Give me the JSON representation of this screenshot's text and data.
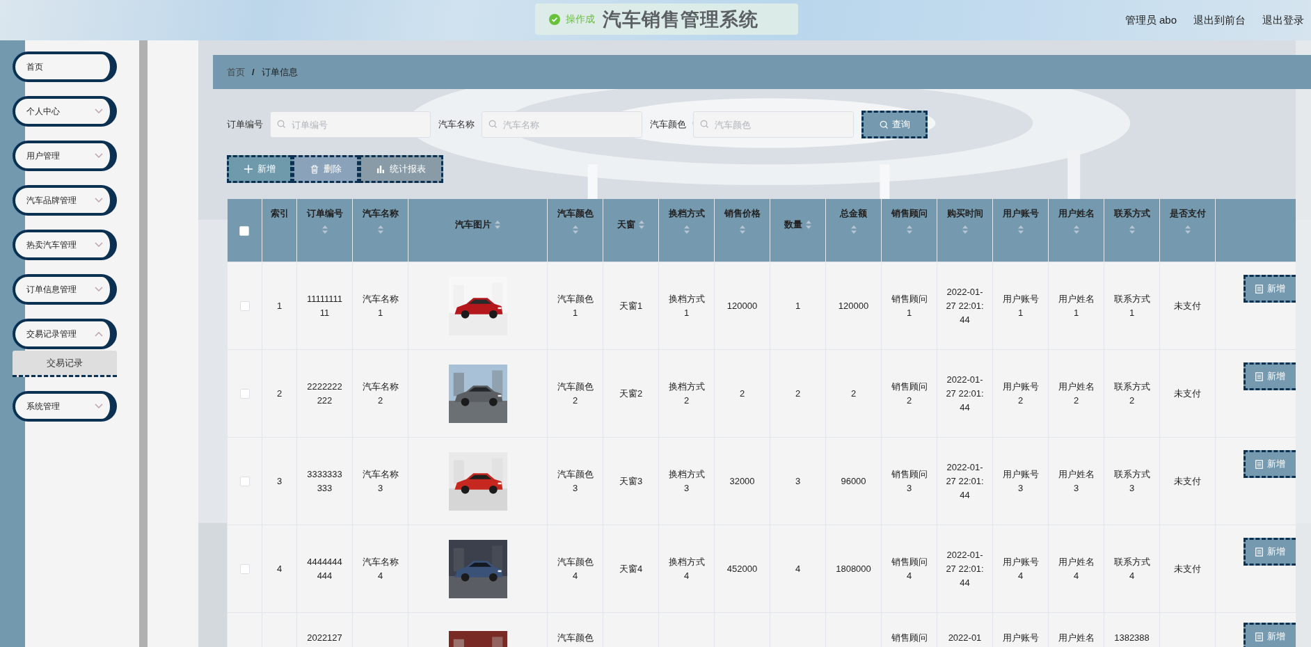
{
  "header": {
    "toast": {
      "text": "操作成"
    },
    "title": "汽车销售管理系统",
    "links": [
      "管理员 abo",
      "退出到前台",
      "退出登录"
    ]
  },
  "sidebar": {
    "items": [
      {
        "label": "首页",
        "kind": "link"
      },
      {
        "label": "个人中心",
        "kind": "group",
        "expanded": false
      },
      {
        "label": "用户管理",
        "kind": "group",
        "expanded": false
      },
      {
        "label": "汽车品牌管理",
        "kind": "group",
        "expanded": false
      },
      {
        "label": "热卖汽车管理",
        "kind": "group",
        "expanded": false
      },
      {
        "label": "订单信息管理",
        "kind": "group",
        "expanded": false
      },
      {
        "label": "交易记录管理",
        "kind": "group",
        "expanded": true,
        "children": [
          {
            "label": "交易记录",
            "hovered": true
          }
        ]
      },
      {
        "label": "系统管理",
        "kind": "group",
        "expanded": false
      }
    ]
  },
  "breadcrumb": {
    "items": [
      "首页",
      "订单信息"
    ],
    "separator": "/"
  },
  "search": {
    "fields": [
      {
        "label": "订单编号",
        "placeholder": "订单编号"
      },
      {
        "label": "汽车名称",
        "placeholder": "汽车名称"
      },
      {
        "label": "汽车颜色",
        "placeholder": "汽车颜色"
      }
    ],
    "button": "查询"
  },
  "toolbar": [
    {
      "label": "新增",
      "kind": "add"
    },
    {
      "label": "删除",
      "kind": "delete"
    },
    {
      "label": "统计报表",
      "kind": "report"
    }
  ],
  "table": {
    "select_all": {
      "checked": false
    },
    "columns": [
      {
        "label": "索引",
        "kind": "plain"
      },
      {
        "label": "订单编号",
        "kind": "sort"
      },
      {
        "label": "汽车名称",
        "kind": "sort"
      },
      {
        "label": "汽车图片",
        "kind": "sort_inline"
      },
      {
        "label": "汽车颜色",
        "kind": "sort"
      },
      {
        "label": "天窗",
        "kind": "sort_inline"
      },
      {
        "label": "换档方式",
        "kind": "sort"
      },
      {
        "label": "销售价格",
        "kind": "sort"
      },
      {
        "label": "数量",
        "kind": "sort_inline"
      },
      {
        "label": "总金额",
        "kind": "sort"
      },
      {
        "label": "销售顾问",
        "kind": "sort"
      },
      {
        "label": "购买时间",
        "kind": "sort"
      },
      {
        "label": "用户账号",
        "kind": "sort"
      },
      {
        "label": "用户姓名",
        "kind": "sort"
      },
      {
        "label": "联系方式",
        "kind": "sort"
      },
      {
        "label": "是否支付",
        "kind": "sort"
      }
    ],
    "rows": [
      {
        "checked": false,
        "cells": [
          "1",
          "1111111111",
          "汽车名称1",
          {
            "kind": "picture"
          },
          "汽车颜色1",
          "天窗1",
          "换档方式1",
          "120000",
          "1",
          "120000",
          "销售顾问1",
          "2022-01-27 22:01:44",
          "用户账号1",
          "用户姓名1",
          "联系方式1",
          "未支付"
        ],
        "actions": [
          "新增"
        ]
      },
      {
        "checked": false,
        "cells": [
          "2",
          "2222222222",
          "汽车名称2",
          {
            "kind": "picture"
          },
          "汽车颜色2",
          "天窗2",
          "换档方式2",
          "2",
          "2",
          "2",
          "销售顾问2",
          "2022-01-27 22:01:44",
          "用户账号2",
          "用户姓名2",
          "联系方式2",
          "未支付"
        ],
        "actions": [
          "新增"
        ]
      },
      {
        "checked": false,
        "cells": [
          "3",
          "3333333333",
          "汽车名称3",
          {
            "kind": "picture"
          },
          "汽车颜色3",
          "天窗3",
          "换档方式3",
          "32000",
          "3",
          "96000",
          "销售顾问3",
          "2022-01-27 22:01:44",
          "用户账号3",
          "用户姓名3",
          "联系方式3",
          "未支付"
        ],
        "actions": [
          "新增"
        ]
      },
      {
        "checked": false,
        "cells": [
          "4",
          "4444444444",
          "汽车名称4",
          {
            "kind": "picture"
          },
          "汽车颜色4",
          "天窗4",
          "换档方式4",
          "452000",
          "4",
          "1808000",
          "销售顾问4",
          "2022-01-27 22:01:44",
          "用户账号4",
          "用户姓名4",
          "联系方式4",
          "未支付"
        ],
        "actions": [
          "新增"
        ]
      },
      {
        "cells": [
          null,
          "2022127",
          null,
          {
            "kind": "picture"
          },
          "汽车颜色",
          null,
          null,
          null,
          null,
          null,
          "销售顾问",
          "2022-01",
          "用户账号",
          "用户姓名",
          "1382388",
          null
        ],
        "actions": [
          "新增"
        ]
      }
    ]
  }
}
